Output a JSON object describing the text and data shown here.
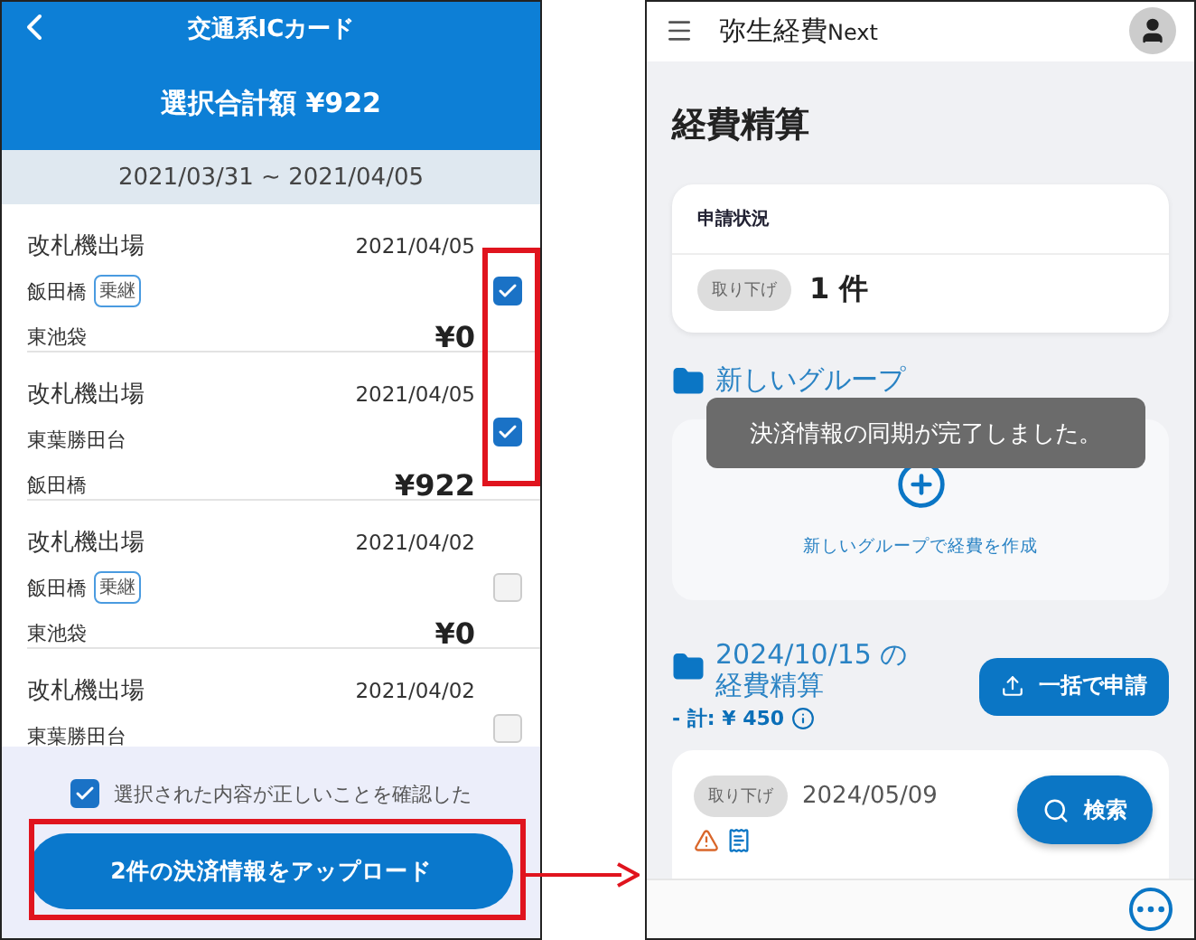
{
  "left_phone": {
    "title": "交通系ICカード",
    "total": "選択合計額 ¥922",
    "period": "2021/03/31 ~ 2021/04/05",
    "transactions": [
      {
        "type": "改札機出場",
        "date": "2021/04/05",
        "from": "飯田橋",
        "transfer": "乗継",
        "to": "東池袋",
        "amount": "¥0",
        "checked": true
      },
      {
        "type": "改札機出場",
        "date": "2021/04/05",
        "from": "東葉勝田台",
        "to": "飯田橋",
        "amount": "¥922",
        "checked": true
      },
      {
        "type": "改札機出場",
        "date": "2021/04/02",
        "from": "飯田橋",
        "transfer": "乗継",
        "to": "東池袋",
        "amount": "¥0",
        "checked": false
      },
      {
        "type": "改札機出場",
        "date": "2021/04/02",
        "from": "東葉勝田台",
        "checked": false
      }
    ],
    "confirm": {
      "label": "選択された内容が正しいことを確認した",
      "checked": true
    },
    "upload_button": "2件の決済情報をアップロード"
  },
  "right_phone": {
    "app_title": "弥生経費",
    "app_title_suffix": "Next",
    "page_title": "経費精算",
    "status_card": {
      "title": "申請状況",
      "chip": "取り下げ",
      "count": "1 件"
    },
    "groups": [
      {
        "kind": "empty",
        "title": "新しいグループ",
        "create_label": "新しいグループで経費を作成"
      },
      {
        "kind": "expense",
        "title": "2024/10/15 の経費精算",
        "total": "- 計: ¥ 450",
        "button": "一括で申請",
        "item": {
          "chip": "取り下げ",
          "date": "2024/05/09"
        }
      }
    ],
    "toast": "決済情報の同期が完了しました。",
    "search_button": "検索"
  }
}
